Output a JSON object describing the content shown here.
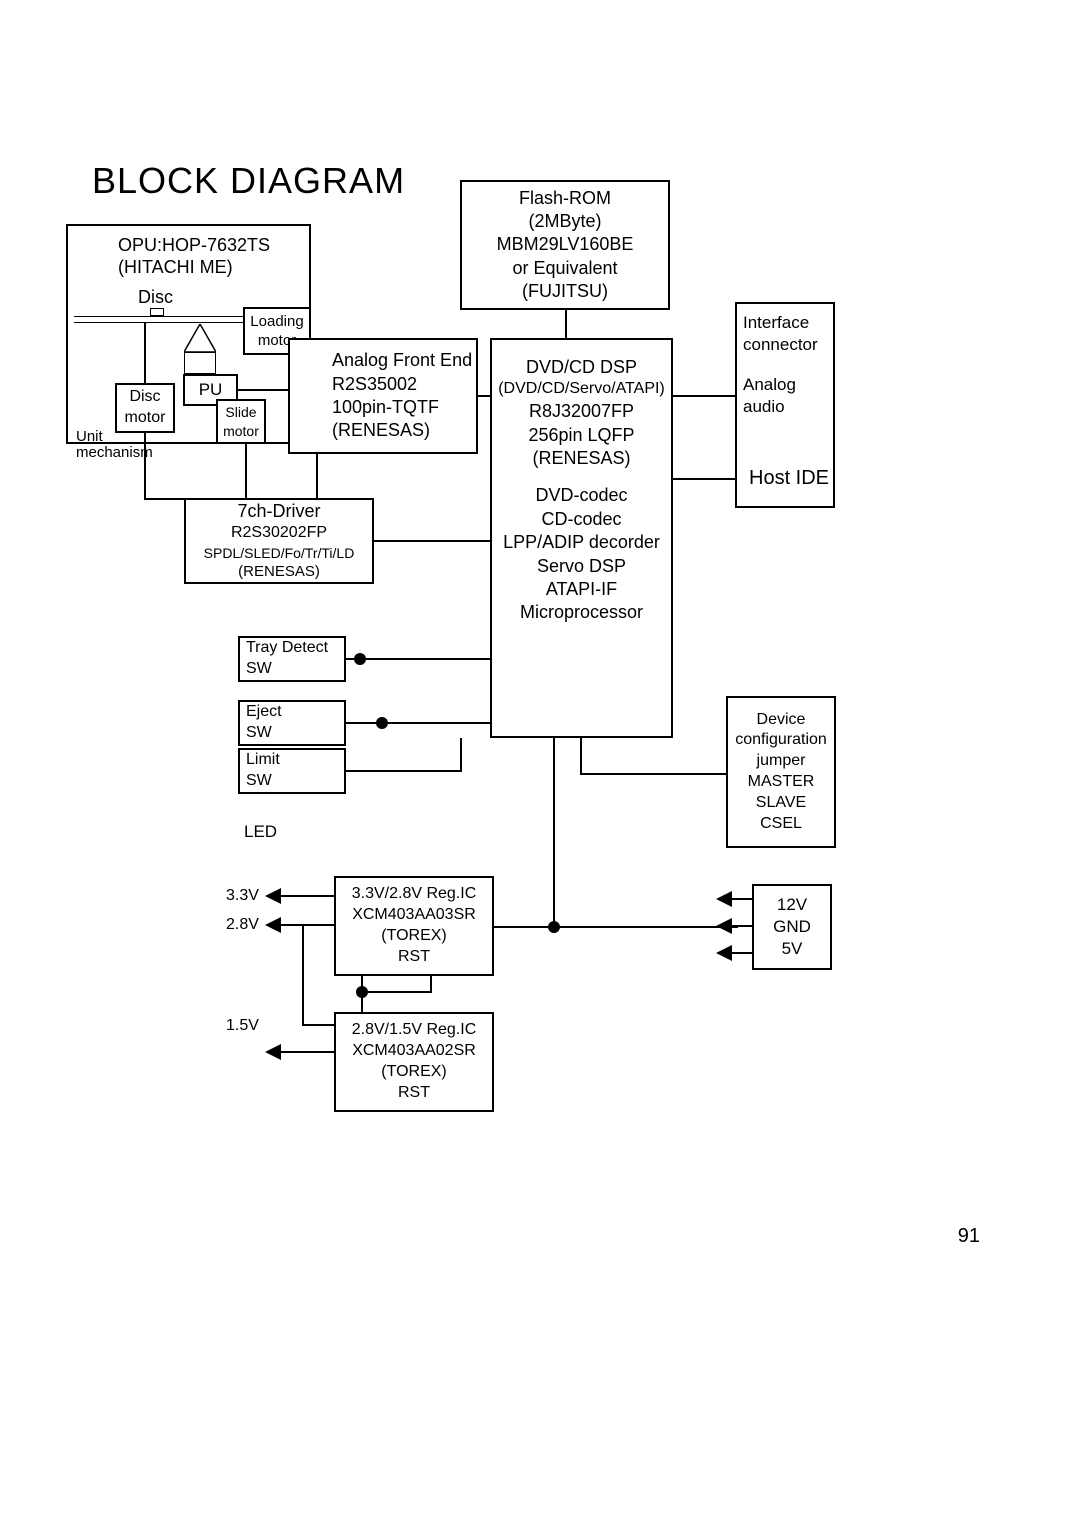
{
  "title": "BLOCK DIAGRAM",
  "pageNumber": "91",
  "flashRom": {
    "line1": "Flash-ROM",
    "line2": "(2MByte)",
    "line3": "MBM29LV160BE",
    "line4": "or Equivalent",
    "line5": "(FUJITSU)"
  },
  "opu": {
    "line1": "OPU:HOP-7632TS",
    "line2": "(HITACHI ME)"
  },
  "disc": "Disc",
  "loadingMotor": {
    "line1": "Loading",
    "line2": "motor"
  },
  "interface": {
    "line1": "Interface",
    "line2": "connector"
  },
  "analog": {
    "line1": "Analog",
    "line2": "audio"
  },
  "hostIde": "Host IDE",
  "pu": "PU",
  "discMotor": {
    "line1": "Disc",
    "line2": "motor"
  },
  "slideMotor": {
    "line1": "Slide",
    "line2": "motor"
  },
  "unitMech": {
    "line1": "Unit",
    "line2": "mechanism"
  },
  "afe": {
    "line1": "Analog Front End",
    "line2": "R2S35002",
    "line3": "100pin-TQTF",
    "line4": "(RENESAS)"
  },
  "dsp": {
    "line1": "DVD/CD DSP",
    "line2": "(DVD/CD/Servo/ATAPI)",
    "line3": "R8J32007FP",
    "line4": "256pin LQFP",
    "line5": "(RENESAS)",
    "line6": "DVD-codec",
    "line7": "CD-codec",
    "line8": "LPP/ADIP decorder",
    "line9": "Servo DSP",
    "line10": "ATAPI-IF",
    "line11": "Microprocessor"
  },
  "driver": {
    "line1": "7ch-Driver",
    "line2": "R2S30202FP",
    "line3": "SPDL/SLED/Fo/Tr/Ti/LD",
    "line4": "(RENESAS)"
  },
  "trayDetect": {
    "line1": "Tray Detect",
    "line2": "SW"
  },
  "eject": {
    "line1": "Eject",
    "line2": "SW"
  },
  "limit": {
    "line1": "Limit",
    "line2": "SW"
  },
  "led": "LED",
  "deviceConfig": {
    "line1": "Device",
    "line2": "configuration",
    "line3": "jumper",
    "line4": "MASTER",
    "line5": "SLAVE",
    "line6": "CSEL"
  },
  "reg1": {
    "line1": "3.3V/2.8V Reg.IC",
    "line2": "XCM403AA03SR",
    "line3": "(TOREX)",
    "line4": "RST"
  },
  "reg2": {
    "line1": "2.8V/1.5V Reg.IC",
    "line2": "XCM403AA02SR",
    "line3": "(TOREX)",
    "line4": "RST"
  },
  "v33": "3.3V",
  "v28": "2.8V",
  "v15": "1.5V",
  "power": {
    "line1": "12V",
    "line2": "GND",
    "line3": "5V"
  }
}
